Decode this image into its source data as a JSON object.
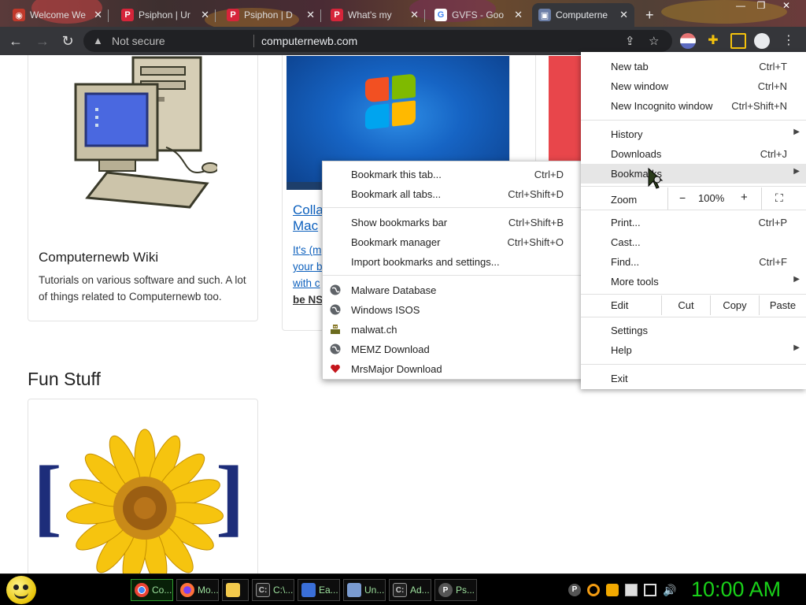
{
  "tabs": [
    {
      "title": "Welcome We",
      "favicon": "chrome"
    },
    {
      "title": "Psiphon | Ur",
      "favicon": "psiphon"
    },
    {
      "title": "Psiphon | D",
      "favicon": "psiphon"
    },
    {
      "title": "What's my",
      "favicon": "psiphon"
    },
    {
      "title": "GVFS - Goo",
      "favicon": "google"
    },
    {
      "title": "Computerne",
      "favicon": "computer",
      "active": true
    }
  ],
  "new_tab_symbol": "+",
  "window_controls": {
    "minimize": "—",
    "maximize": "❐",
    "close": "✕"
  },
  "toolbar": {
    "security_text": "Not secure",
    "url": "computernewb.com"
  },
  "page": {
    "cards": [
      {
        "title": "Computernewb Wiki",
        "desc": "Tutorials on various software and such. A lot of things related to Computernewb too."
      },
      {
        "title": "Colla\nMac",
        "desc_lines": [
          "It's (m",
          "your b",
          "with c",
          "be NS"
        ]
      }
    ],
    "section_title": "Fun Stuff"
  },
  "chrome_menu": {
    "new_tab": {
      "label": "New tab",
      "shortcut": "Ctrl+T"
    },
    "new_window": {
      "label": "New window",
      "shortcut": "Ctrl+N"
    },
    "new_incognito": {
      "label": "New Incognito window",
      "shortcut": "Ctrl+Shift+N"
    },
    "history": {
      "label": "History"
    },
    "downloads": {
      "label": "Downloads",
      "shortcut": "Ctrl+J"
    },
    "bookmarks": {
      "label": "Bookmarks"
    },
    "zoom": {
      "label": "Zoom",
      "minus": "−",
      "value": "100%",
      "plus": "+"
    },
    "print": {
      "label": "Print...",
      "shortcut": "Ctrl+P"
    },
    "cast": {
      "label": "Cast..."
    },
    "find": {
      "label": "Find...",
      "shortcut": "Ctrl+F"
    },
    "more_tools": {
      "label": "More tools"
    },
    "edit": {
      "label": "Edit",
      "cut": "Cut",
      "copy": "Copy",
      "paste": "Paste"
    },
    "settings": {
      "label": "Settings"
    },
    "help": {
      "label": "Help"
    },
    "exit": {
      "label": "Exit"
    }
  },
  "bookmarks_menu": {
    "bookmark_tab": {
      "label": "Bookmark this tab...",
      "shortcut": "Ctrl+D"
    },
    "bookmark_all": {
      "label": "Bookmark all tabs...",
      "shortcut": "Ctrl+Shift+D"
    },
    "show_bar": {
      "label": "Show bookmarks bar",
      "shortcut": "Ctrl+Shift+B"
    },
    "manager": {
      "label": "Bookmark manager",
      "shortcut": "Ctrl+Shift+O"
    },
    "import": {
      "label": "Import bookmarks and settings..."
    },
    "items": [
      {
        "label": "Malware Database",
        "icon": "globe-icon"
      },
      {
        "label": "Windows ISOS",
        "icon": "globe-icon"
      },
      {
        "label": "malwat.ch",
        "icon": "malwatch-icon"
      },
      {
        "label": "MEMZ Download",
        "icon": "globe-icon"
      },
      {
        "label": "MrsMajor Download",
        "icon": "heart-icon"
      }
    ]
  },
  "taskbar": {
    "items": [
      {
        "label": "Co...",
        "icon": "chrome-icon",
        "active": true
      },
      {
        "label": "Mo...",
        "icon": "firefox-icon"
      },
      {
        "label": "",
        "icon": "folder-icon"
      },
      {
        "label": "C:\\...",
        "icon": "cmd-icon"
      },
      {
        "label": "Ea...",
        "icon": "app-icon"
      },
      {
        "label": "Un...",
        "icon": "installer-icon"
      },
      {
        "label": "Ad...",
        "icon": "cmd-icon"
      },
      {
        "label": "Ps...",
        "icon": "psiphon-icon"
      }
    ],
    "clock": "10:00 AM"
  },
  "colors": {
    "toolbar_bg": "#35363a",
    "omnibox_bg": "#202124",
    "taskbar_text": "#19d019",
    "accent_red": "#e8464b"
  }
}
